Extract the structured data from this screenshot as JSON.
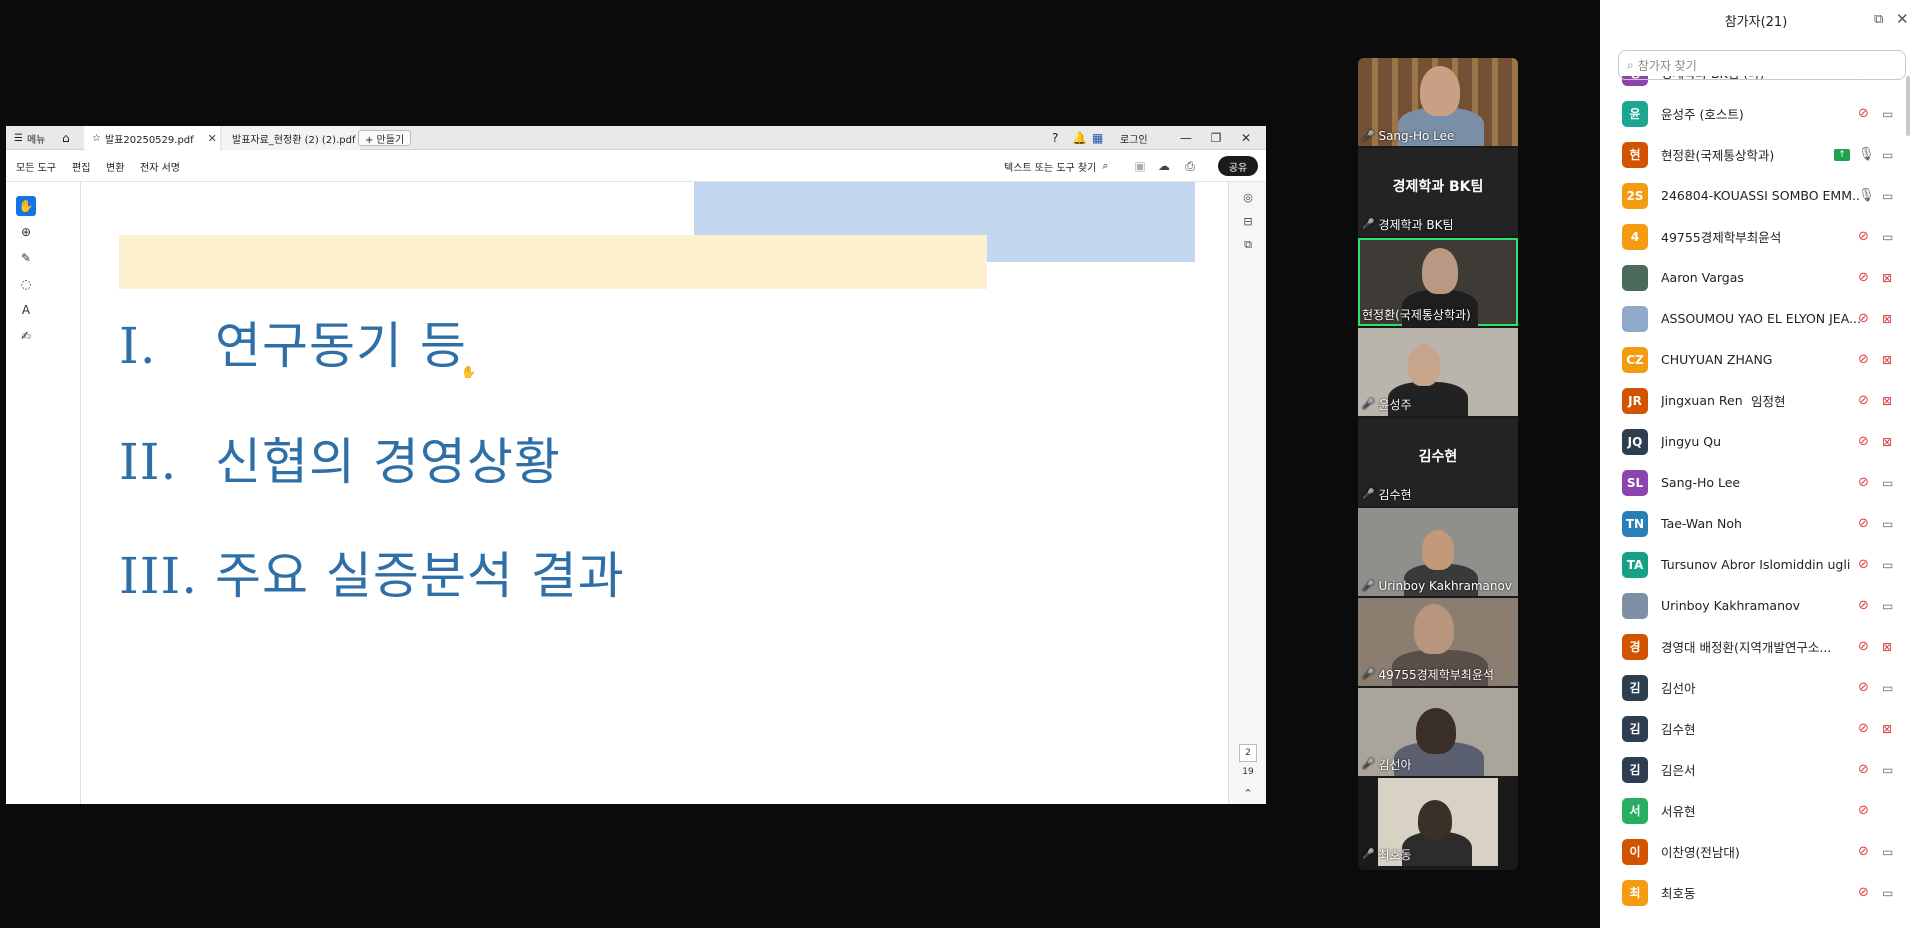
{
  "pdf_viewer": {
    "menu_label": "메뉴",
    "tabs": [
      {
        "label": "발표20250529.pdf",
        "active": true
      },
      {
        "label": "발표자료_현정환 (2) (2).pdf",
        "active": false
      }
    ],
    "new_tab_label": "+ 만들기",
    "login_label": "로그인",
    "menu_items": [
      "모든 도구",
      "편집",
      "변환",
      "전자 서명"
    ],
    "search_label": "텍스트 또는 도구 찾기",
    "share_label": "공유",
    "page_current": "2",
    "page_total": "19",
    "slide": {
      "items": [
        {
          "num": "I.",
          "text": "연구동기 등"
        },
        {
          "num": "II.",
          "text": "신협의 경영상황"
        },
        {
          "num": "III.",
          "text": "주요 실증분석 결과"
        }
      ]
    }
  },
  "gallery": {
    "tiles": [
      {
        "label": "Sang-Ho Lee",
        "muted": true,
        "video": true
      },
      {
        "label": "경제학과 BK팀",
        "bigname": "경제학과 BK팀",
        "muted": true,
        "video": false
      },
      {
        "label": "현정환(국제통상학과)",
        "muted": false,
        "video": true,
        "speaking": true
      },
      {
        "label": "윤성주",
        "muted": true,
        "video": true
      },
      {
        "label": "김수현",
        "bigname": "김수현",
        "muted": true,
        "video": false
      },
      {
        "label": "Urinboy Kakhramanov",
        "muted": true,
        "video": true
      },
      {
        "label": "49755경제학부최윤석",
        "muted": true,
        "video": true
      },
      {
        "label": "김선아",
        "muted": true,
        "video": true
      },
      {
        "label": "최호동",
        "muted": true,
        "video": true
      }
    ]
  },
  "participants": {
    "title": "참가자(21)",
    "search_placeholder": "참가자 찾기",
    "list": [
      {
        "initial": "경",
        "color": "#8e44ad",
        "name": "경제학과 BK팀 (나)",
        "mic": "off",
        "cam": "none"
      },
      {
        "initial": "윤",
        "color": "#1aa68f",
        "name": "윤성주 (호스트)",
        "mic": "off",
        "cam": "on"
      },
      {
        "initial": "현",
        "color": "#d35400",
        "name": "현정환(국제통상학과)",
        "mic": "on",
        "cam": "on",
        "sharing": true
      },
      {
        "initial": "2S",
        "color": "#f39c12",
        "name": "246804-KOUASSI SOMBO EMM...",
        "mic": "on",
        "cam": "on"
      },
      {
        "initial": "4",
        "color": "#f39c12",
        "name": "49755경제학부최윤석",
        "mic": "off",
        "cam": "on"
      },
      {
        "initial": "",
        "color": "#4a6b5a",
        "name": "Aaron Vargas",
        "mic": "off",
        "cam": "off",
        "photo": true
      },
      {
        "initial": "",
        "color": "#8fa9c8",
        "name": "ASSOUMOU YAO EL ELYON JEA...",
        "mic": "off",
        "cam": "off",
        "photo": true
      },
      {
        "initial": "CZ",
        "color": "#f39c12",
        "name": "CHUYUAN ZHANG",
        "mic": "off",
        "cam": "off"
      },
      {
        "initial": "JR",
        "color": "#d35400",
        "name": "Jingxuan Ren",
        "extra": "임정현",
        "mic": "off",
        "cam": "off"
      },
      {
        "initial": "JQ",
        "color": "#2c3e50",
        "name": "Jingyu Qu",
        "mic": "off",
        "cam": "off"
      },
      {
        "initial": "SL",
        "color": "#8e44ad",
        "name": "Sang-Ho Lee",
        "mic": "off",
        "cam": "on"
      },
      {
        "initial": "TN",
        "color": "#2980b9",
        "name": "Tae-Wan Noh",
        "mic": "off",
        "cam": "on"
      },
      {
        "initial": "TA",
        "color": "#16a085",
        "name": "Tursunov Abror Islomiddin ugli",
        "mic": "off",
        "cam": "on"
      },
      {
        "initial": "",
        "color": "#7f8fa6",
        "name": "Urinboy Kakhramanov",
        "mic": "off",
        "cam": "on",
        "photo": true
      },
      {
        "initial": "경",
        "color": "#d35400",
        "name": "경영대 배정환(지역개발연구소...",
        "mic": "off",
        "cam": "off"
      },
      {
        "initial": "김",
        "color": "#2c3e50",
        "name": "김선아",
        "mic": "off",
        "cam": "on"
      },
      {
        "initial": "김",
        "color": "#2c3e50",
        "name": "김수현",
        "mic": "off",
        "cam": "off"
      },
      {
        "initial": "김",
        "color": "#2c3e50",
        "name": "김은서",
        "mic": "off",
        "cam": "on"
      },
      {
        "initial": "서",
        "color": "#27ae60",
        "name": "서유현",
        "mic": "off",
        "cam": "none"
      },
      {
        "initial": "이",
        "color": "#d35400",
        "name": "이찬영(전남대)",
        "mic": "off",
        "cam": "on"
      },
      {
        "initial": "최",
        "color": "#f39c12",
        "name": "최호동",
        "mic": "off",
        "cam": "on"
      }
    ]
  }
}
